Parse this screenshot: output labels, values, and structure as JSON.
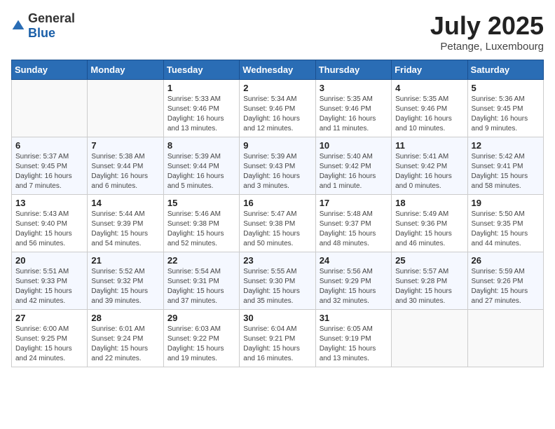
{
  "header": {
    "logo_general": "General",
    "logo_blue": "Blue",
    "month_year": "July 2025",
    "location": "Petange, Luxembourg"
  },
  "days_of_week": [
    "Sunday",
    "Monday",
    "Tuesday",
    "Wednesday",
    "Thursday",
    "Friday",
    "Saturday"
  ],
  "weeks": [
    [
      {
        "day": "",
        "sunrise": "",
        "sunset": "",
        "daylight": ""
      },
      {
        "day": "",
        "sunrise": "",
        "sunset": "",
        "daylight": ""
      },
      {
        "day": "1",
        "sunrise": "Sunrise: 5:33 AM",
        "sunset": "Sunset: 9:46 PM",
        "daylight": "Daylight: 16 hours and 13 minutes."
      },
      {
        "day": "2",
        "sunrise": "Sunrise: 5:34 AM",
        "sunset": "Sunset: 9:46 PM",
        "daylight": "Daylight: 16 hours and 12 minutes."
      },
      {
        "day": "3",
        "sunrise": "Sunrise: 5:35 AM",
        "sunset": "Sunset: 9:46 PM",
        "daylight": "Daylight: 16 hours and 11 minutes."
      },
      {
        "day": "4",
        "sunrise": "Sunrise: 5:35 AM",
        "sunset": "Sunset: 9:46 PM",
        "daylight": "Daylight: 16 hours and 10 minutes."
      },
      {
        "day": "5",
        "sunrise": "Sunrise: 5:36 AM",
        "sunset": "Sunset: 9:45 PM",
        "daylight": "Daylight: 16 hours and 9 minutes."
      }
    ],
    [
      {
        "day": "6",
        "sunrise": "Sunrise: 5:37 AM",
        "sunset": "Sunset: 9:45 PM",
        "daylight": "Daylight: 16 hours and 7 minutes."
      },
      {
        "day": "7",
        "sunrise": "Sunrise: 5:38 AM",
        "sunset": "Sunset: 9:44 PM",
        "daylight": "Daylight: 16 hours and 6 minutes."
      },
      {
        "day": "8",
        "sunrise": "Sunrise: 5:39 AM",
        "sunset": "Sunset: 9:44 PM",
        "daylight": "Daylight: 16 hours and 5 minutes."
      },
      {
        "day": "9",
        "sunrise": "Sunrise: 5:39 AM",
        "sunset": "Sunset: 9:43 PM",
        "daylight": "Daylight: 16 hours and 3 minutes."
      },
      {
        "day": "10",
        "sunrise": "Sunrise: 5:40 AM",
        "sunset": "Sunset: 9:42 PM",
        "daylight": "Daylight: 16 hours and 1 minute."
      },
      {
        "day": "11",
        "sunrise": "Sunrise: 5:41 AM",
        "sunset": "Sunset: 9:42 PM",
        "daylight": "Daylight: 16 hours and 0 minutes."
      },
      {
        "day": "12",
        "sunrise": "Sunrise: 5:42 AM",
        "sunset": "Sunset: 9:41 PM",
        "daylight": "Daylight: 15 hours and 58 minutes."
      }
    ],
    [
      {
        "day": "13",
        "sunrise": "Sunrise: 5:43 AM",
        "sunset": "Sunset: 9:40 PM",
        "daylight": "Daylight: 15 hours and 56 minutes."
      },
      {
        "day": "14",
        "sunrise": "Sunrise: 5:44 AM",
        "sunset": "Sunset: 9:39 PM",
        "daylight": "Daylight: 15 hours and 54 minutes."
      },
      {
        "day": "15",
        "sunrise": "Sunrise: 5:46 AM",
        "sunset": "Sunset: 9:38 PM",
        "daylight": "Daylight: 15 hours and 52 minutes."
      },
      {
        "day": "16",
        "sunrise": "Sunrise: 5:47 AM",
        "sunset": "Sunset: 9:38 PM",
        "daylight": "Daylight: 15 hours and 50 minutes."
      },
      {
        "day": "17",
        "sunrise": "Sunrise: 5:48 AM",
        "sunset": "Sunset: 9:37 PM",
        "daylight": "Daylight: 15 hours and 48 minutes."
      },
      {
        "day": "18",
        "sunrise": "Sunrise: 5:49 AM",
        "sunset": "Sunset: 9:36 PM",
        "daylight": "Daylight: 15 hours and 46 minutes."
      },
      {
        "day": "19",
        "sunrise": "Sunrise: 5:50 AM",
        "sunset": "Sunset: 9:35 PM",
        "daylight": "Daylight: 15 hours and 44 minutes."
      }
    ],
    [
      {
        "day": "20",
        "sunrise": "Sunrise: 5:51 AM",
        "sunset": "Sunset: 9:33 PM",
        "daylight": "Daylight: 15 hours and 42 minutes."
      },
      {
        "day": "21",
        "sunrise": "Sunrise: 5:52 AM",
        "sunset": "Sunset: 9:32 PM",
        "daylight": "Daylight: 15 hours and 39 minutes."
      },
      {
        "day": "22",
        "sunrise": "Sunrise: 5:54 AM",
        "sunset": "Sunset: 9:31 PM",
        "daylight": "Daylight: 15 hours and 37 minutes."
      },
      {
        "day": "23",
        "sunrise": "Sunrise: 5:55 AM",
        "sunset": "Sunset: 9:30 PM",
        "daylight": "Daylight: 15 hours and 35 minutes."
      },
      {
        "day": "24",
        "sunrise": "Sunrise: 5:56 AM",
        "sunset": "Sunset: 9:29 PM",
        "daylight": "Daylight: 15 hours and 32 minutes."
      },
      {
        "day": "25",
        "sunrise": "Sunrise: 5:57 AM",
        "sunset": "Sunset: 9:28 PM",
        "daylight": "Daylight: 15 hours and 30 minutes."
      },
      {
        "day": "26",
        "sunrise": "Sunrise: 5:59 AM",
        "sunset": "Sunset: 9:26 PM",
        "daylight": "Daylight: 15 hours and 27 minutes."
      }
    ],
    [
      {
        "day": "27",
        "sunrise": "Sunrise: 6:00 AM",
        "sunset": "Sunset: 9:25 PM",
        "daylight": "Daylight: 15 hours and 24 minutes."
      },
      {
        "day": "28",
        "sunrise": "Sunrise: 6:01 AM",
        "sunset": "Sunset: 9:24 PM",
        "daylight": "Daylight: 15 hours and 22 minutes."
      },
      {
        "day": "29",
        "sunrise": "Sunrise: 6:03 AM",
        "sunset": "Sunset: 9:22 PM",
        "daylight": "Daylight: 15 hours and 19 minutes."
      },
      {
        "day": "30",
        "sunrise": "Sunrise: 6:04 AM",
        "sunset": "Sunset: 9:21 PM",
        "daylight": "Daylight: 15 hours and 16 minutes."
      },
      {
        "day": "31",
        "sunrise": "Sunrise: 6:05 AM",
        "sunset": "Sunset: 9:19 PM",
        "daylight": "Daylight: 15 hours and 13 minutes."
      },
      {
        "day": "",
        "sunrise": "",
        "sunset": "",
        "daylight": ""
      },
      {
        "day": "",
        "sunrise": "",
        "sunset": "",
        "daylight": ""
      }
    ]
  ]
}
